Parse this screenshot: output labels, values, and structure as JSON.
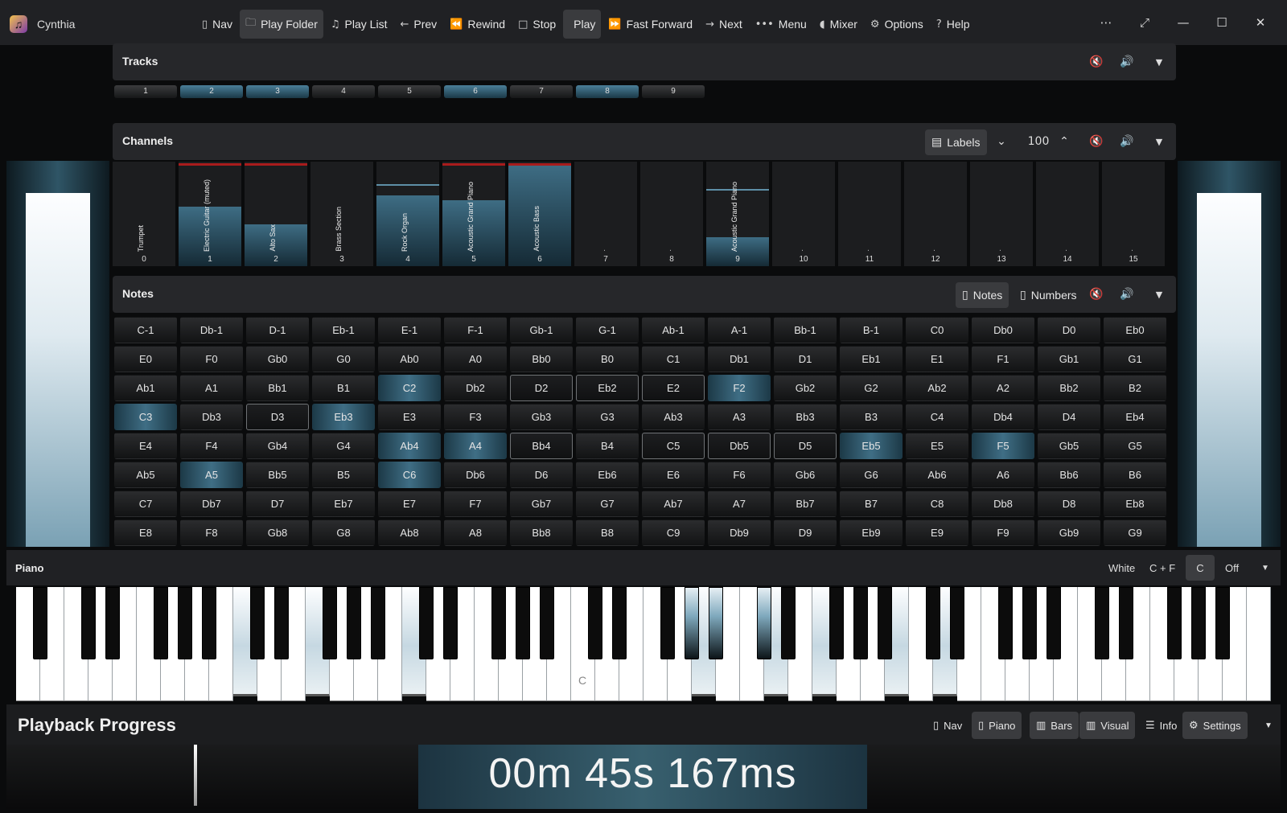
{
  "app": {
    "title": "Cynthia"
  },
  "toolbar": {
    "items": [
      {
        "label": "Nav",
        "icon": "sidebar-icon",
        "active": false
      },
      {
        "label": "Play Folder",
        "icon": "folder-icon",
        "active": true
      },
      {
        "label": "Play List",
        "icon": "music-note-icon",
        "active": false
      },
      {
        "label": "Prev",
        "icon": "arrow-left-icon",
        "active": false
      },
      {
        "label": "Rewind",
        "icon": "rewind-icon",
        "active": false
      },
      {
        "label": "Stop",
        "icon": "stop-icon",
        "active": false
      },
      {
        "label": "Play",
        "icon": "play-icon",
        "active": true
      },
      {
        "label": "Fast Forward",
        "icon": "fast-forward-icon",
        "active": false
      },
      {
        "label": "Next",
        "icon": "arrow-right-icon",
        "active": false
      },
      {
        "label": "Menu",
        "icon": "more-icon",
        "active": false
      },
      {
        "label": "Mixer",
        "icon": "speaker-icon",
        "active": false
      },
      {
        "label": "Options",
        "icon": "options-icon",
        "active": false
      },
      {
        "label": "Help",
        "icon": "help-icon",
        "active": false
      }
    ]
  },
  "tracks": {
    "title": "Tracks",
    "items": [
      {
        "label": "1",
        "active": false
      },
      {
        "label": "2",
        "active": true
      },
      {
        "label": "3",
        "active": true
      },
      {
        "label": "4",
        "active": false
      },
      {
        "label": "5",
        "active": false
      },
      {
        "label": "6",
        "active": true
      },
      {
        "label": "7",
        "active": false
      },
      {
        "label": "8",
        "active": true
      },
      {
        "label": "9",
        "active": false
      }
    ]
  },
  "channels": {
    "title": "Channels",
    "labels_button": "Labels",
    "volume": "100",
    "items": [
      {
        "num": "0",
        "name": "Trumpet",
        "level": 0,
        "marker": null,
        "peak": false
      },
      {
        "num": "1",
        "name": "Electric Guitar (muted)",
        "level": 0.57,
        "marker": null,
        "peak": true
      },
      {
        "num": "2",
        "name": "Alto Sax",
        "level": 0.4,
        "marker": null,
        "peak": true
      },
      {
        "num": "3",
        "name": "Brass Section",
        "level": 0,
        "marker": null,
        "peak": false
      },
      {
        "num": "4",
        "name": "Rock Organ",
        "level": 0.68,
        "marker": 0.77,
        "peak": false
      },
      {
        "num": "5",
        "name": "Acoustic Grand Piano",
        "level": 0.63,
        "marker": null,
        "peak": true
      },
      {
        "num": "6",
        "name": "Acoustic Bass",
        "level": 0.97,
        "marker": null,
        "peak": true
      },
      {
        "num": "7",
        "name": ".",
        "level": 0,
        "marker": null,
        "peak": false
      },
      {
        "num": "8",
        "name": ".",
        "level": 0,
        "marker": null,
        "peak": false
      },
      {
        "num": "9",
        "name": "Acoustic Grand Piano",
        "level": 0.28,
        "marker": 0.72,
        "peak": false
      },
      {
        "num": "10",
        "name": ".",
        "level": 0,
        "marker": null,
        "peak": false
      },
      {
        "num": "11",
        "name": ".",
        "level": 0,
        "marker": null,
        "peak": false
      },
      {
        "num": "12",
        "name": ".",
        "level": 0,
        "marker": null,
        "peak": false
      },
      {
        "num": "13",
        "name": ".",
        "level": 0,
        "marker": null,
        "peak": false
      },
      {
        "num": "14",
        "name": ".",
        "level": 0,
        "marker": null,
        "peak": false
      },
      {
        "num": "15",
        "name": ".",
        "level": 0,
        "marker": null,
        "peak": false
      }
    ]
  },
  "notes": {
    "title": "Notes",
    "notes_button": "Notes",
    "numbers_button": "Numbers",
    "items": [
      {
        "label": "C-1",
        "state": ""
      },
      {
        "label": "Db-1",
        "state": ""
      },
      {
        "label": "D-1",
        "state": ""
      },
      {
        "label": "Eb-1",
        "state": ""
      },
      {
        "label": "E-1",
        "state": ""
      },
      {
        "label": "F-1",
        "state": ""
      },
      {
        "label": "Gb-1",
        "state": ""
      },
      {
        "label": "G-1",
        "state": ""
      },
      {
        "label": "Ab-1",
        "state": ""
      },
      {
        "label": "A-1",
        "state": ""
      },
      {
        "label": "Bb-1",
        "state": ""
      },
      {
        "label": "B-1",
        "state": ""
      },
      {
        "label": "C0",
        "state": ""
      },
      {
        "label": "Db0",
        "state": ""
      },
      {
        "label": "D0",
        "state": ""
      },
      {
        "label": "Eb0",
        "state": ""
      },
      {
        "label": "E0",
        "state": ""
      },
      {
        "label": "F0",
        "state": ""
      },
      {
        "label": "Gb0",
        "state": ""
      },
      {
        "label": "G0",
        "state": ""
      },
      {
        "label": "Ab0",
        "state": ""
      },
      {
        "label": "A0",
        "state": ""
      },
      {
        "label": "Bb0",
        "state": ""
      },
      {
        "label": "B0",
        "state": ""
      },
      {
        "label": "C1",
        "state": ""
      },
      {
        "label": "Db1",
        "state": ""
      },
      {
        "label": "D1",
        "state": ""
      },
      {
        "label": "Eb1",
        "state": ""
      },
      {
        "label": "E1",
        "state": ""
      },
      {
        "label": "F1",
        "state": ""
      },
      {
        "label": "Gb1",
        "state": ""
      },
      {
        "label": "G1",
        "state": ""
      },
      {
        "label": "Ab1",
        "state": ""
      },
      {
        "label": "A1",
        "state": ""
      },
      {
        "label": "Bb1",
        "state": ""
      },
      {
        "label": "B1",
        "state": ""
      },
      {
        "label": "C2",
        "state": "on"
      },
      {
        "label": "Db2",
        "state": ""
      },
      {
        "label": "D2",
        "state": "out"
      },
      {
        "label": "Eb2",
        "state": "out"
      },
      {
        "label": "E2",
        "state": "out"
      },
      {
        "label": "F2",
        "state": "on"
      },
      {
        "label": "Gb2",
        "state": ""
      },
      {
        "label": "G2",
        "state": ""
      },
      {
        "label": "Ab2",
        "state": ""
      },
      {
        "label": "A2",
        "state": ""
      },
      {
        "label": "Bb2",
        "state": ""
      },
      {
        "label": "B2",
        "state": ""
      },
      {
        "label": "C3",
        "state": "on"
      },
      {
        "label": "Db3",
        "state": ""
      },
      {
        "label": "D3",
        "state": "out"
      },
      {
        "label": "Eb3",
        "state": "on"
      },
      {
        "label": "E3",
        "state": ""
      },
      {
        "label": "F3",
        "state": ""
      },
      {
        "label": "Gb3",
        "state": ""
      },
      {
        "label": "G3",
        "state": ""
      },
      {
        "label": "Ab3",
        "state": ""
      },
      {
        "label": "A3",
        "state": ""
      },
      {
        "label": "Bb3",
        "state": ""
      },
      {
        "label": "B3",
        "state": ""
      },
      {
        "label": "C4",
        "state": ""
      },
      {
        "label": "Db4",
        "state": ""
      },
      {
        "label": "D4",
        "state": ""
      },
      {
        "label": "Eb4",
        "state": ""
      },
      {
        "label": "E4",
        "state": ""
      },
      {
        "label": "F4",
        "state": ""
      },
      {
        "label": "Gb4",
        "state": ""
      },
      {
        "label": "G4",
        "state": ""
      },
      {
        "label": "Ab4",
        "state": "on"
      },
      {
        "label": "A4",
        "state": "on"
      },
      {
        "label": "Bb4",
        "state": "out"
      },
      {
        "label": "B4",
        "state": ""
      },
      {
        "label": "C5",
        "state": "out"
      },
      {
        "label": "Db5",
        "state": "out"
      },
      {
        "label": "D5",
        "state": "out"
      },
      {
        "label": "Eb5",
        "state": "on"
      },
      {
        "label": "E5",
        "state": ""
      },
      {
        "label": "F5",
        "state": "on"
      },
      {
        "label": "Gb5",
        "state": ""
      },
      {
        "label": "G5",
        "state": ""
      },
      {
        "label": "Ab5",
        "state": ""
      },
      {
        "label": "A5",
        "state": "on"
      },
      {
        "label": "Bb5",
        "state": ""
      },
      {
        "label": "B5",
        "state": ""
      },
      {
        "label": "C6",
        "state": "on"
      },
      {
        "label": "Db6",
        "state": ""
      },
      {
        "label": "D6",
        "state": ""
      },
      {
        "label": "Eb6",
        "state": ""
      },
      {
        "label": "E6",
        "state": ""
      },
      {
        "label": "F6",
        "state": ""
      },
      {
        "label": "Gb6",
        "state": ""
      },
      {
        "label": "G6",
        "state": ""
      },
      {
        "label": "Ab6",
        "state": ""
      },
      {
        "label": "A6",
        "state": ""
      },
      {
        "label": "Bb6",
        "state": ""
      },
      {
        "label": "B6",
        "state": ""
      },
      {
        "label": "C7",
        "state": ""
      },
      {
        "label": "Db7",
        "state": ""
      },
      {
        "label": "D7",
        "state": ""
      },
      {
        "label": "Eb7",
        "state": ""
      },
      {
        "label": "E7",
        "state": ""
      },
      {
        "label": "F7",
        "state": ""
      },
      {
        "label": "Gb7",
        "state": ""
      },
      {
        "label": "G7",
        "state": ""
      },
      {
        "label": "Ab7",
        "state": ""
      },
      {
        "label": "A7",
        "state": ""
      },
      {
        "label": "Bb7",
        "state": ""
      },
      {
        "label": "B7",
        "state": ""
      },
      {
        "label": "C8",
        "state": ""
      },
      {
        "label": "Db8",
        "state": ""
      },
      {
        "label": "D8",
        "state": ""
      },
      {
        "label": "Eb8",
        "state": ""
      },
      {
        "label": "E8",
        "state": ""
      },
      {
        "label": "F8",
        "state": ""
      },
      {
        "label": "Gb8",
        "state": ""
      },
      {
        "label": "G8",
        "state": ""
      },
      {
        "label": "Ab8",
        "state": ""
      },
      {
        "label": "A8",
        "state": ""
      },
      {
        "label": "Bb8",
        "state": ""
      },
      {
        "label": "B8",
        "state": ""
      },
      {
        "label": "C9",
        "state": ""
      },
      {
        "label": "Db9",
        "state": ""
      },
      {
        "label": "D9",
        "state": ""
      },
      {
        "label": "Eb9",
        "state": ""
      },
      {
        "label": "E9",
        "state": ""
      },
      {
        "label": "F9",
        "state": ""
      },
      {
        "label": "Gb9",
        "state": ""
      },
      {
        "label": "G9",
        "state": ""
      }
    ]
  },
  "piano": {
    "title": "Piano",
    "white_label": "White",
    "cf_label": "C + F",
    "c_label": "C",
    "off_label": "Off",
    "middle_c": "C",
    "pressed_white": [
      9,
      12,
      16,
      28,
      31,
      33,
      36,
      38
    ],
    "pressed_black": [
      18,
      27,
      28,
      30
    ]
  },
  "playback": {
    "title": "Playback Progress",
    "progress": 0.147,
    "time": "00m 45s 167ms",
    "buttons": [
      {
        "label": "Nav",
        "icon": "sidebar-icon",
        "active": false
      },
      {
        "label": "Piano",
        "icon": "sidebar-icon",
        "active": true
      },
      {
        "label": "Bars",
        "icon": "bars-icon",
        "active": true
      },
      {
        "label": "Visual",
        "icon": "bars-icon",
        "active": true
      },
      {
        "label": "Info",
        "icon": "list-icon",
        "active": false
      },
      {
        "label": "Settings",
        "icon": "gear-icon",
        "active": true
      }
    ]
  }
}
